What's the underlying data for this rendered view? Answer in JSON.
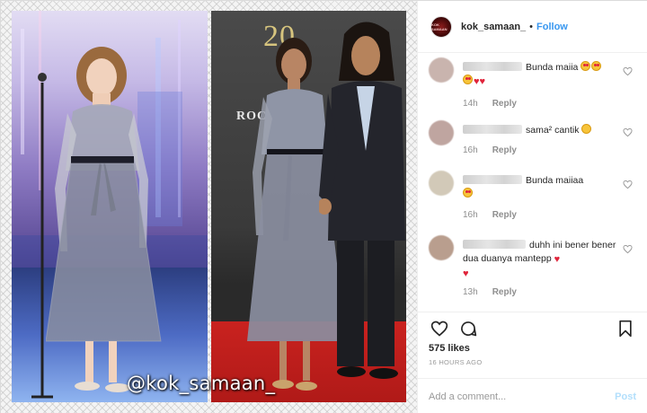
{
  "header": {
    "username": "kok_samaan_",
    "separator": "•",
    "follow_label": "Follow",
    "avatar_text": "KOK SAMAAN"
  },
  "media": {
    "watermark": "@kok_samaan_",
    "backdrop_number": "20",
    "backdrop_text": "ROC"
  },
  "comments": [
    {
      "text": "Bunda maiia",
      "time": "14h",
      "reply": "Reply",
      "avatar_color": "#c9b4ae"
    },
    {
      "text": "sama² cantik",
      "time": "16h",
      "reply": "Reply",
      "avatar_color": "#bfa5a0"
    },
    {
      "text": "Bunda maiiaa",
      "time": "16h",
      "reply": "Reply",
      "avatar_color": "#d2c9b8"
    },
    {
      "text": "duhh ini bener bener dua duanya mantepp",
      "time": "13h",
      "reply": "Reply",
      "avatar_color": "#b99e8e"
    }
  ],
  "actions": {
    "likes": "575 likes",
    "timestamp": "16 HOURS AGO"
  },
  "add_comment": {
    "placeholder": "Add a comment...",
    "post_label": "Post"
  },
  "colors": {
    "link_blue": "#3897f0",
    "post_disabled": "#b2dffc",
    "heart_red": "#e0243a"
  }
}
